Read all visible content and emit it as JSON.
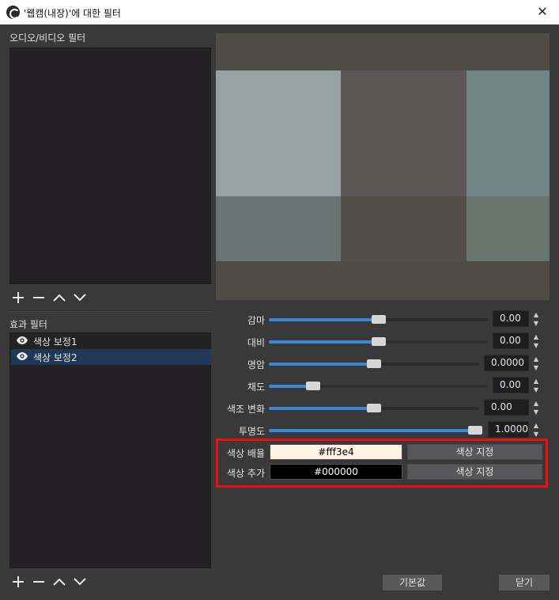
{
  "window": {
    "title": "'웹캠(내장)'에 대한 필터",
    "close_glyph": "✕"
  },
  "av_filters": {
    "label": "오디오/비디오 필터"
  },
  "effect_filters": {
    "label": "효과 필터",
    "items": [
      {
        "label": "색상 보정1",
        "icon": "eye-icon",
        "selected": false
      },
      {
        "label": "색상 보정2",
        "icon": "eye-icon",
        "selected": true
      }
    ]
  },
  "toolbar_icons": [
    "plus-icon",
    "minus-icon",
    "chevron-up-icon",
    "chevron-down-icon"
  ],
  "properties": {
    "gamma": {
      "label": "감마",
      "value": "0.00",
      "fraction": 0.5
    },
    "contrast": {
      "label": "대비",
      "value": "0.00",
      "fraction": 0.5
    },
    "brightness": {
      "label": "명암",
      "value": "0.0000",
      "fraction": 0.5
    },
    "saturation": {
      "label": "채도",
      "value": "0.00",
      "fraction": 0.18
    },
    "hue_shift": {
      "label": "색조 변화",
      "value": "0.00",
      "fraction": 0.5
    },
    "opacity": {
      "label": "투명도",
      "value": "1.0000",
      "fraction": 1.0
    },
    "color_multiply": {
      "label": "색상 배율",
      "value": "#fff3e4",
      "color": "#fff3e4",
      "button": "색상 지정"
    },
    "color_add": {
      "label": "색상 추가",
      "value": "#000000",
      "color": "#000000",
      "button": "색상 지정"
    }
  },
  "buttons": {
    "defaults": "기본값",
    "close": "닫기"
  },
  "colors": {
    "window_bg": "#3a393a",
    "list_bg": "#232124",
    "selected_row": "#1e3856",
    "accent": "#3a89d7",
    "highlight_border": "#ee1010"
  }
}
